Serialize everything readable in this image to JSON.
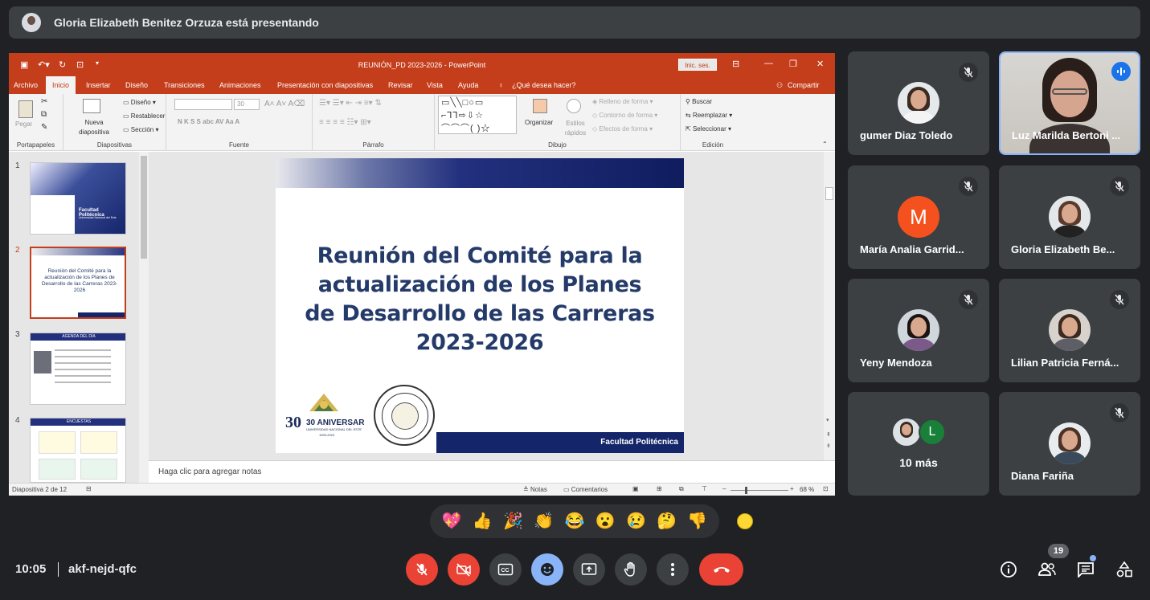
{
  "presenter_bar": {
    "text": "Gloria Elizabeth Benitez Orzuza está presentando"
  },
  "ppt": {
    "window_title": "REUNIÓN_PD 2023-2026  -  PowerPoint",
    "login_button": "Inic. ses.",
    "menu": [
      "Archivo",
      "Inicio",
      "Insertar",
      "Diseño",
      "Transiciones",
      "Animaciones",
      "Presentación con diapositivas",
      "Revisar",
      "Vista",
      "Ayuda",
      "¿Qué desea hacer?"
    ],
    "share": "Compartir",
    "ribbon": {
      "portapapeles": {
        "label": "Portapapeles",
        "paste": "Pegar"
      },
      "diapositivas": {
        "label": "Diapositivas",
        "new_slide": "Nueva diapositiva",
        "layout": "Diseño",
        "reset": "Restablecer",
        "section": "Sección"
      },
      "fuente": {
        "label": "Fuente",
        "size": "30",
        "buttons": "N  K  S  S  abc  AV  Aa  A"
      },
      "parrafo": {
        "label": "Párrafo"
      },
      "dibujo": {
        "label": "Dibujo",
        "arrange": "Organizar",
        "styles": "Estilos rápidos",
        "fill": "Relleno de forma",
        "outline": "Contorno de forma",
        "effects": "Efectos de forma"
      },
      "edicion": {
        "label": "Edición",
        "find": "Buscar",
        "replace": "Reemplazar",
        "select": "Seleccionar"
      }
    },
    "slides": [
      {
        "num": "1",
        "title": "Facultad Politécnica",
        "sub": "Universidad Nacional del Este"
      },
      {
        "num": "2",
        "title": "Reunión del Comité para la actualización de los Planes de Desarrollo de las Carreras 2023-2026"
      },
      {
        "num": "3",
        "title": "AGENDA DEL DÍA"
      },
      {
        "num": "4",
        "title": "ENCUESTAS"
      }
    ],
    "slide": {
      "title": "Reunión del Comité para la actualización de los Planes de Desarrollo de las Carreras 2023-2026",
      "footer": "Facultad Politécnica",
      "logo_text": "30 ANIVERSARIO",
      "logo_sub": "UNIVERSIDAD NACIONAL DEL ESTE",
      "logo_years": "1993-2023"
    },
    "notes_placeholder": "Haga clic para agregar notas",
    "status": {
      "slide_info": "Diapositiva 2 de 12",
      "notes": "Notas",
      "comments": "Comentarios",
      "zoom": "68 %"
    }
  },
  "participants": [
    {
      "name": "gumer Diaz Toledo",
      "muted": true
    },
    {
      "name": "Luz Marilda Bertoni ...",
      "speaking": true
    },
    {
      "name": "María Analia Garrid...",
      "initial": "M",
      "color": "#f4511e",
      "muted": true
    },
    {
      "name": "Gloria Elizabeth Be...",
      "muted": true
    },
    {
      "name": "Yeny Mendoza",
      "muted": true
    },
    {
      "name": "Lilian Patricia Ferná...",
      "muted": true
    },
    {
      "name": "10 más",
      "extra_initial": "L",
      "extra_color": "#188038"
    },
    {
      "name": "Diana Fariña",
      "muted": true
    }
  ],
  "reactions": [
    "💖",
    "👍",
    "🎉",
    "👏",
    "😂",
    "😮",
    "😢",
    "🤔",
    "👎"
  ],
  "footer": {
    "time": "10:05",
    "meeting_code": "akf-nejd-qfc",
    "people_count": "19"
  }
}
